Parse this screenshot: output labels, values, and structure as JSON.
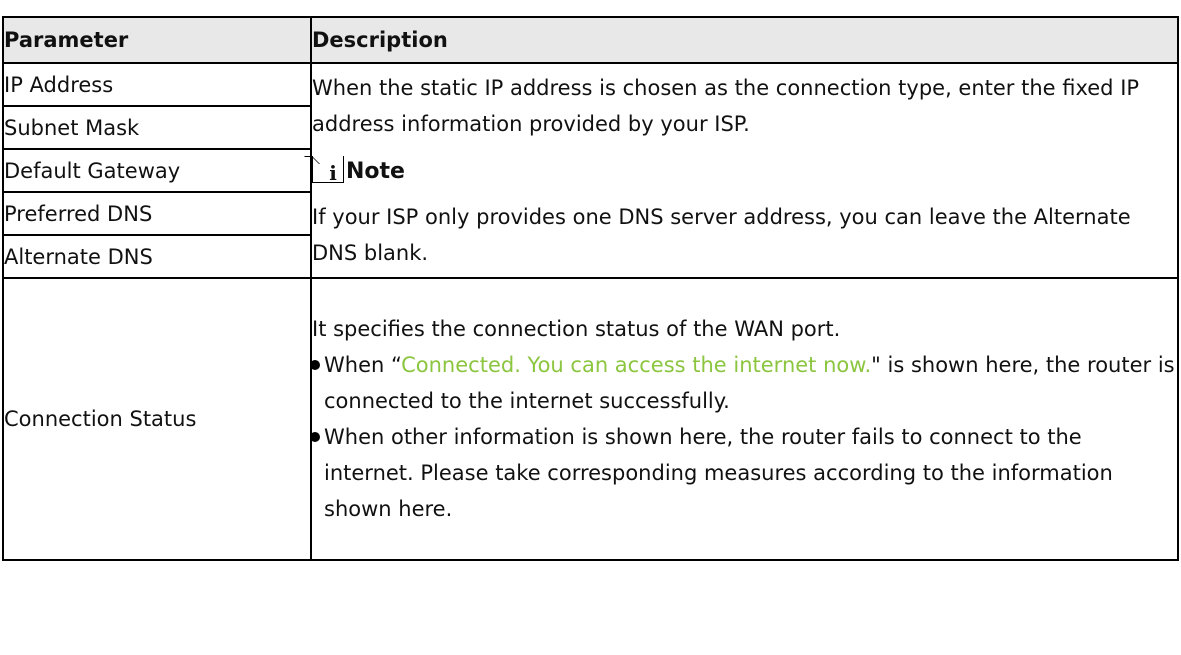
{
  "table": {
    "headers": [
      "Parameter",
      "Description"
    ],
    "static_params": [
      "IP Address",
      "Subnet Mask",
      "Default Gateway",
      "Preferred DNS",
      "Alternate DNS"
    ],
    "static_description": "When the static IP address is chosen as the connection type, enter the fixed IP address information provided by your ISP.",
    "note_icon_letter": "i",
    "note_label": "Note",
    "note_text": "If your ISP only provides one DNS server address, you can leave the Alternate DNS blank.",
    "status_param": "Connection Status",
    "status_intro": "It specifies the connection status of the WAN port.",
    "bullet1_prefix": "When “",
    "bullet1_highlight": "Connected. You can access the internet now.",
    "bullet1_suffix": "\" is shown here, the router is connected to the internet successfully.",
    "bullet2": "When other information is shown here, the router fails to connect to the internet. Please take corresponding measures according to the information shown here.",
    "highlight_color": "#8cc640",
    "note_icon_name": "info-note-icon"
  }
}
